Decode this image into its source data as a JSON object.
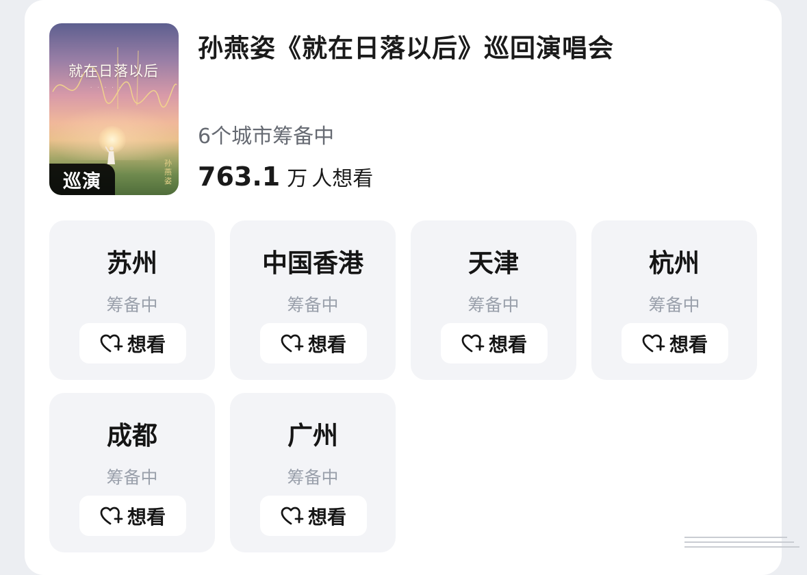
{
  "tour": {
    "title": "孙燕姿《就在日落以后》巡回演唱会",
    "status": "6个城市筹备中",
    "interest_number": "763.1",
    "interest_unit": "万",
    "interest_suffix": "人想看",
    "poster": {
      "title": "就在日落以后",
      "badge": "巡演",
      "side_text": "孙燕姿"
    }
  },
  "cities": [
    {
      "name": "苏州",
      "status": "筹备中",
      "button": "想看"
    },
    {
      "name": "中国香港",
      "status": "筹备中",
      "button": "想看"
    },
    {
      "name": "天津",
      "status": "筹备中",
      "button": "想看"
    },
    {
      "name": "杭州",
      "status": "筹备中",
      "button": "想看"
    },
    {
      "name": "成都",
      "status": "筹备中",
      "button": "想看"
    },
    {
      "name": "广州",
      "status": "筹备中",
      "button": "想看"
    }
  ],
  "icons": {
    "want": "heart-plus-icon"
  },
  "colors": {
    "card_bg": "#ffffff",
    "page_bg": "#eceef2",
    "city_tile_bg": "#f3f4f7",
    "status_gray": "#9aa0ab",
    "title_text": "#1a1a1a"
  }
}
